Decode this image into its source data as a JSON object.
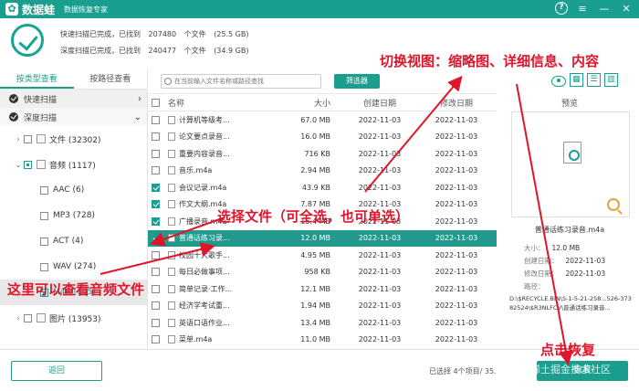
{
  "titlebar": {
    "app_name": "数据蛙",
    "subtitle": "数据恢复专家",
    "help_glyph": "?",
    "menu_glyph": "≡",
    "minimize_glyph": "—",
    "close_glyph": "✕"
  },
  "status": {
    "quick": {
      "label": "快速扫描已完成，已找到",
      "count": "207480",
      "unit": "个文件",
      "size": "(25.5 GB)"
    },
    "deep": {
      "label": "深度扫描已完成，已找到",
      "count": "240477",
      "unit": "个文件",
      "size": "(34.9 GB)"
    }
  },
  "left": {
    "tabs": [
      "按类型查看",
      "按路径查看"
    ],
    "scan_quick": "快速扫描",
    "scan_deep": "深度扫描",
    "tree": [
      {
        "label": "文件 (32302)"
      },
      {
        "label": "音频 (1117)"
      },
      {
        "label": "AAC (6)"
      },
      {
        "label": "MP3 (728)"
      },
      {
        "label": "ACT (4)"
      },
      {
        "label": "WAV (274)"
      },
      {
        "label": "M4A (105)"
      },
      {
        "label": "图片 (13953)"
      }
    ]
  },
  "center": {
    "search_placeholder": "在当前输入文件名称或路径查找",
    "filter_label": "筛选器",
    "columns": {
      "name": "名称",
      "size": "大小",
      "created": "创建日期",
      "modified": "修改日期"
    },
    "rows": [
      {
        "name": "计算机等级考...",
        "size": "67.0 MB",
        "created": "2022-11-03",
        "modified": "2022-11-03",
        "checked": false
      },
      {
        "name": "论文要点录音...",
        "size": "16.0 MB",
        "created": "2022-11-03",
        "modified": "2022-11-03",
        "checked": false
      },
      {
        "name": "重要内容录音...",
        "size": "716 KB",
        "created": "2022-11-03",
        "modified": "2022-11-03",
        "checked": false
      },
      {
        "name": "音乐.m4a",
        "size": "2.94 MB",
        "created": "2022-11-03",
        "modified": "2022-11-03",
        "checked": false
      },
      {
        "name": "会议记录.m4a",
        "size": "43.9 KB",
        "created": "2022-11-03",
        "modified": "2022-11-03",
        "checked": true
      },
      {
        "name": "作文大纲.m4a",
        "size": "7.87 MB",
        "created": "2022-11-03",
        "modified": "2022-11-03",
        "checked": true
      },
      {
        "name": "广播录音.m4a",
        "size": "15.4 MB",
        "created": "2022-11-03",
        "modified": "2022-11-03",
        "checked": true
      },
      {
        "name": "普通话练习录...",
        "size": "12.0 MB",
        "created": "2022-11-03",
        "modified": "2022-11-03",
        "checked": true,
        "selected": true
      },
      {
        "name": "校园十大歌手...",
        "size": "4.95 MB",
        "created": "2022-11-03",
        "modified": "2022-11-03",
        "checked": false
      },
      {
        "name": "每日必做事项...",
        "size": "958 KB",
        "created": "2022-11-03",
        "modified": "2022-11-03",
        "checked": false
      },
      {
        "name": "简单记录·工作...",
        "size": "12.1 MB",
        "created": "2022-11-03",
        "modified": "2022-11-03",
        "checked": false
      },
      {
        "name": "经济学考试重...",
        "size": "1.94 MB",
        "created": "2022-11-03",
        "modified": "2022-11-03",
        "checked": false
      },
      {
        "name": "英语口语作业...",
        "size": "13.4 MB",
        "created": "2022-11-03",
        "modified": "2022-11-03",
        "checked": false
      },
      {
        "name": "菜单.m4a",
        "size": "11.0 MB",
        "created": "2022-11-03",
        "modified": "2022-11-03",
        "checked": false
      }
    ]
  },
  "right": {
    "title": "预览",
    "file_name": "普通话练习录音.m4a",
    "size_label": "大小：",
    "size_value": "12.0 MB",
    "created_label": "创建日期：",
    "created_value": "2022-11-03",
    "modified_label": "修改日期：",
    "modified_value": "2022-11-03",
    "path_label": "路径：",
    "path_value": "D:\\$RECYCLE.BIN\\S-1-5-21-258...526-37382524\\$R3NLFCV\\普通话练习录音..."
  },
  "bottom": {
    "back_label": "返回",
    "selection_info": "已选择 4个项目/ 35.",
    "recover_label": "恢复"
  },
  "annotations": {
    "view_switch": "切换视图：缩略图、详细信息、内容",
    "select_files": "选择文件（可全选，也可单选）",
    "audio_here": "这里可以查看音频文件",
    "click_recover": "点击恢复",
    "watermark": "@稀土掘金技术社区"
  },
  "colors": {
    "accent": "#1a9e8f",
    "annotation": "#e0142b"
  }
}
